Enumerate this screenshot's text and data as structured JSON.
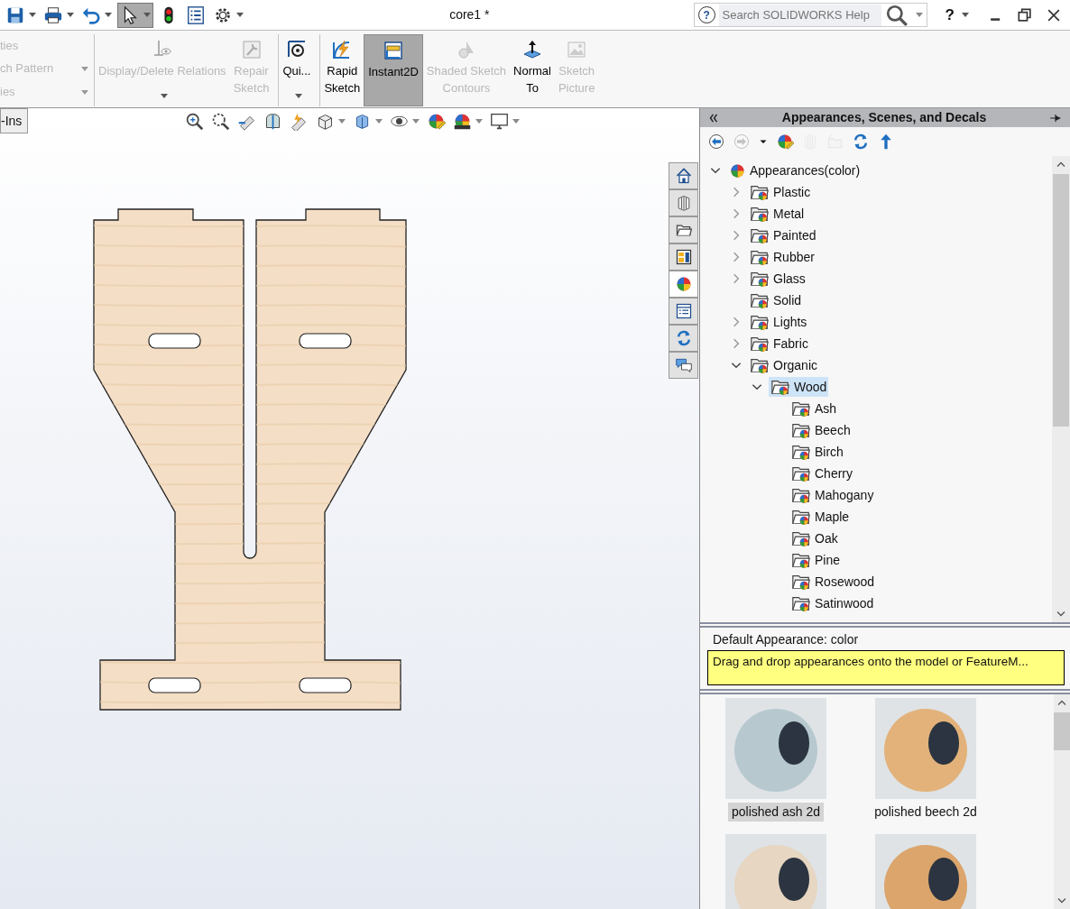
{
  "window": {
    "title": "core1 *"
  },
  "quick_access": [
    {
      "kind": "save",
      "dropdown": true,
      "pressed": false
    },
    {
      "kind": "print",
      "dropdown": true,
      "pressed": false
    },
    {
      "kind": "undo",
      "dropdown": true,
      "pressed": false
    },
    {
      "kind": "select",
      "dropdown": true,
      "pressed": true
    },
    {
      "kind": "traffic-light",
      "dropdown": false,
      "pressed": false
    },
    {
      "kind": "list",
      "dropdown": false,
      "pressed": false
    },
    {
      "kind": "gear",
      "dropdown": true,
      "pressed": false
    }
  ],
  "help_search": {
    "icon": "?",
    "placeholder": "Search SOLIDWORKS Help"
  },
  "help_button": {
    "label": "?"
  },
  "ribbon": {
    "cut_group": [
      {
        "label": "ties",
        "dropdown": false
      },
      {
        "label": "ch Pattern",
        "dropdown": true
      },
      {
        "label": "ies",
        "dropdown": true
      }
    ],
    "tools": [
      {
        "kind": "relations",
        "label": "Display/Delete Relations",
        "disabled": true,
        "selected": false,
        "dropdown": true,
        "group_start": true
      },
      {
        "kind": "repair",
        "label": "Repair\nSketch",
        "disabled": true,
        "selected": false,
        "dropdown": false,
        "group_start": false
      },
      {
        "kind": "quick-snaps",
        "label": "Qui...",
        "disabled": false,
        "selected": false,
        "dropdown": true,
        "group_start": true
      },
      {
        "kind": "rapid-sketch",
        "label": "Rapid\nSketch",
        "disabled": false,
        "selected": false,
        "dropdown": false,
        "group_start": true
      },
      {
        "kind": "instant2d",
        "label": "Instant2D",
        "disabled": false,
        "selected": true,
        "dropdown": false,
        "group_start": false
      },
      {
        "kind": "shaded",
        "label": "Shaded Sketch\nContours",
        "disabled": true,
        "selected": false,
        "dropdown": false,
        "group_start": false
      },
      {
        "kind": "normal-to",
        "label": "Normal\nTo",
        "disabled": false,
        "selected": false,
        "dropdown": false,
        "group_start": false
      },
      {
        "kind": "picture",
        "label": "Sketch\nPicture",
        "disabled": true,
        "selected": false,
        "dropdown": false,
        "group_start": false
      }
    ]
  },
  "viewport": {
    "tab": {
      "label": "-Ins"
    },
    "view_toolbar": [
      {
        "kind": "zoom-fit",
        "dropdown": false
      },
      {
        "kind": "zoom-area",
        "dropdown": false
      },
      {
        "kind": "previous-view",
        "dropdown": false
      },
      {
        "kind": "section-view",
        "dropdown": false
      },
      {
        "kind": "annotation",
        "dropdown": false
      },
      {
        "kind": "orientation",
        "dropdown": true
      },
      {
        "kind": "display-style",
        "dropdown": true
      },
      {
        "kind": "hide-show",
        "dropdown": true
      },
      {
        "kind": "edit-appearance",
        "dropdown": false
      },
      {
        "kind": "scene",
        "dropdown": true
      },
      {
        "kind": "monitor",
        "dropdown": true
      }
    ],
    "task_tabs": [
      {
        "kind": "home",
        "selected": false
      },
      {
        "kind": "parts",
        "selected": false
      },
      {
        "kind": "folder",
        "selected": false
      },
      {
        "kind": "palette",
        "selected": false
      },
      {
        "kind": "appearance",
        "selected": true
      },
      {
        "kind": "properties",
        "selected": false
      },
      {
        "kind": "refresh",
        "selected": false
      },
      {
        "kind": "forum",
        "selected": false
      }
    ]
  },
  "panel": {
    "title": "Appearances, Scenes, and Decals",
    "toolbar": [
      {
        "kind": "back",
        "disabled": false
      },
      {
        "kind": "forward",
        "disabled": true
      },
      {
        "kind": "caret",
        "disabled": false
      },
      {
        "kind": "edit-appearance",
        "disabled": false
      },
      {
        "kind": "parts",
        "disabled": true
      },
      {
        "kind": "new-folder",
        "disabled": true
      },
      {
        "kind": "refresh",
        "disabled": false
      },
      {
        "kind": "up",
        "disabled": false
      }
    ],
    "tree": [
      {
        "label": "Appearances(color)",
        "kind": "root",
        "expanded": true,
        "selected": false,
        "children": [
          {
            "label": "Plastic",
            "kind": "branch",
            "expanded": false,
            "selected": false
          },
          {
            "label": "Metal",
            "kind": "branch",
            "expanded": false,
            "selected": false
          },
          {
            "label": "Painted",
            "kind": "branch",
            "expanded": false,
            "selected": false
          },
          {
            "label": "Rubber",
            "kind": "branch",
            "expanded": false,
            "selected": false
          },
          {
            "label": "Glass",
            "kind": "branch",
            "expanded": false,
            "selected": false
          },
          {
            "label": "Solid",
            "kind": "leaf",
            "selected": false
          },
          {
            "label": "Lights",
            "kind": "branch",
            "expanded": false,
            "selected": false
          },
          {
            "label": "Fabric",
            "kind": "branch",
            "expanded": false,
            "selected": false
          },
          {
            "label": "Organic",
            "kind": "branch",
            "expanded": true,
            "selected": false,
            "children": [
              {
                "label": "Wood",
                "kind": "branch",
                "expanded": true,
                "selected": true,
                "children": [
                  {
                    "label": "Ash",
                    "kind": "leaf",
                    "selected": false
                  },
                  {
                    "label": "Beech",
                    "kind": "leaf",
                    "selected": false
                  },
                  {
                    "label": "Birch",
                    "kind": "leaf",
                    "selected": false
                  },
                  {
                    "label": "Cherry",
                    "kind": "leaf",
                    "selected": false
                  },
                  {
                    "label": "Mahogany",
                    "kind": "leaf",
                    "selected": false
                  },
                  {
                    "label": "Maple",
                    "kind": "leaf",
                    "selected": false
                  },
                  {
                    "label": "Oak",
                    "kind": "leaf",
                    "selected": false
                  },
                  {
                    "label": "Pine",
                    "kind": "leaf",
                    "selected": false
                  },
                  {
                    "label": "Rosewood",
                    "kind": "leaf",
                    "selected": false
                  },
                  {
                    "label": "Satinwood",
                    "kind": "leaf",
                    "selected": false
                  }
                ]
              }
            ]
          }
        ]
      }
    ],
    "default_appearance": "Default Appearance: color",
    "hint": "Drag and drop appearances onto the model or FeatureM...",
    "thumbnails": [
      {
        "caption": "polished ash 2d",
        "color": "#b7c9cf",
        "selected": true
      },
      {
        "caption": "polished beech 2d",
        "color": "#e3b27a",
        "selected": false
      },
      {
        "color": "#e6d6c2",
        "selected": false
      },
      {
        "color": "#dba56c",
        "selected": false
      }
    ]
  }
}
